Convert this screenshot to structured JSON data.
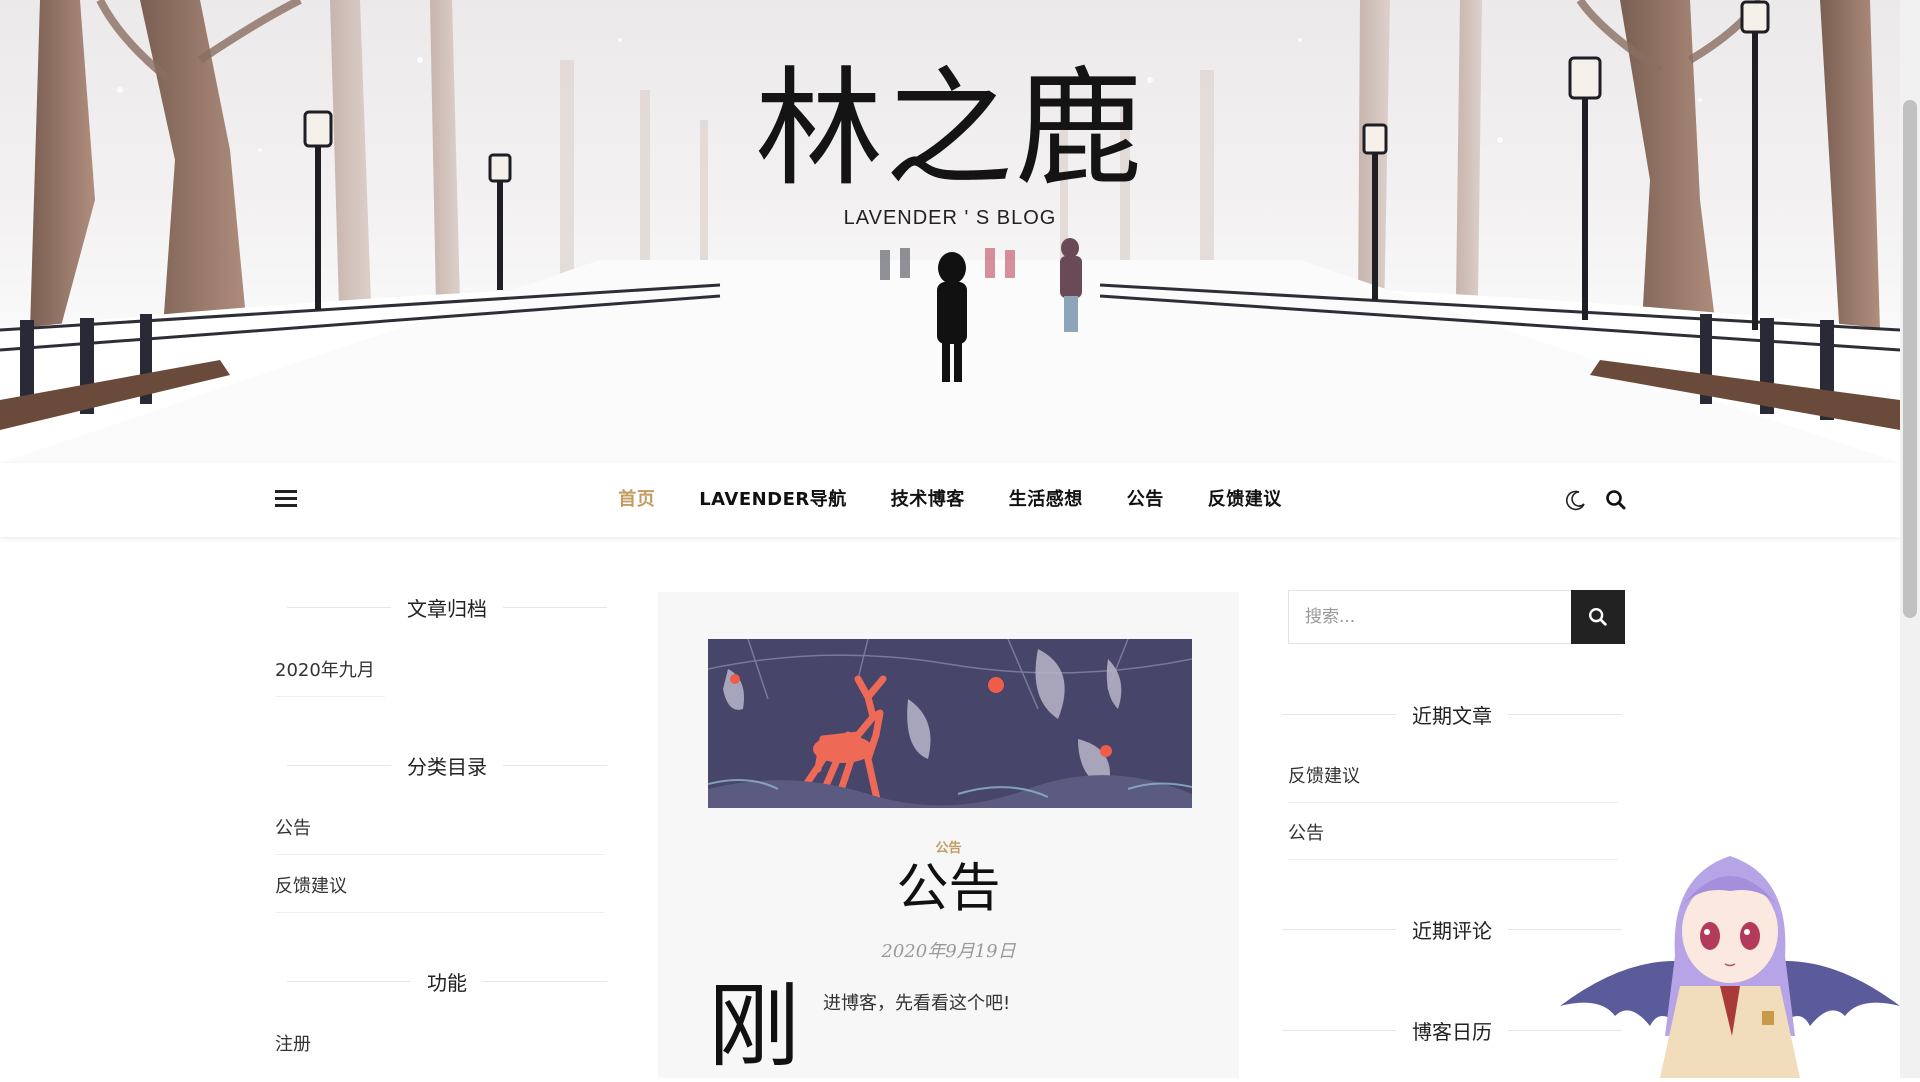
{
  "site": {
    "title": "林之鹿",
    "tagline": "LAVENDER ' S BLOG"
  },
  "nav": {
    "items": [
      {
        "label": "首页",
        "active": true
      },
      {
        "label": "LAVENDER导航",
        "active": false
      },
      {
        "label": "技术博客",
        "active": false
      },
      {
        "label": "生活感想",
        "active": false
      },
      {
        "label": "公告",
        "active": false
      },
      {
        "label": "反馈建议",
        "active": false
      }
    ],
    "accent_color": "#c19c63",
    "icons": {
      "menu": "hamburger-menu-icon",
      "dark_mode": "moon-icon",
      "search": "search-icon"
    }
  },
  "left_sidebar": {
    "archives": {
      "title": "文章归档",
      "items": [
        "2020年九月"
      ]
    },
    "categories": {
      "title": "分类目录",
      "items": [
        "公告",
        "反馈建议"
      ]
    },
    "functions": {
      "title": "功能",
      "items": [
        "注册"
      ]
    }
  },
  "post": {
    "category": "公告",
    "title": "公告",
    "date": "2020年9月19日",
    "drop_cap": "刚",
    "excerpt": "进博客，先看看这个吧!"
  },
  "right_sidebar": {
    "search": {
      "placeholder": "搜索..."
    },
    "recent_posts": {
      "title": "近期文章",
      "items": [
        "反馈建议",
        "公告"
      ]
    },
    "recent_comments": {
      "title": "近期评论"
    },
    "calendar": {
      "title": "博客日历"
    }
  }
}
